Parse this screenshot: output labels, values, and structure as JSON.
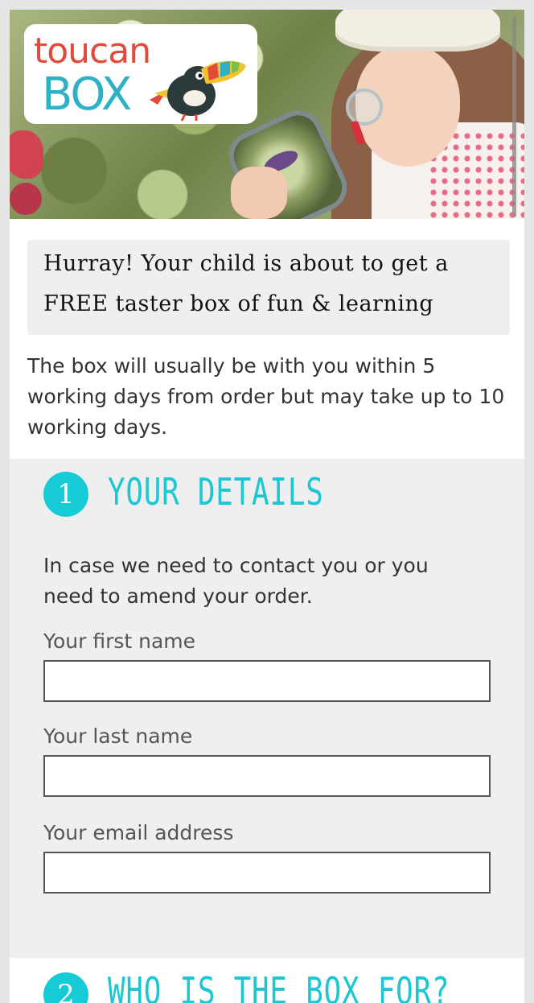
{
  "logo": {
    "word_top": "toucan",
    "word_bottom": "BOX"
  },
  "banner": {
    "line1": "Hurray! Your child is about to get a",
    "line2": "FREE taster box of fun & learning"
  },
  "intro_text": "The box will usually be with you within 5 working days from order but may take up to 10 working days.",
  "section1": {
    "number": "1",
    "title": "YOUR DETAILS",
    "description": "In case we need to contact you or you need to amend your order.",
    "fields": [
      {
        "label": "Your first name",
        "value": ""
      },
      {
        "label": "Your last name",
        "value": ""
      },
      {
        "label": "Your email address",
        "value": ""
      }
    ]
  },
  "section2": {
    "number": "2",
    "title": "WHO IS THE BOX FOR?"
  },
  "colors": {
    "accent": "#1cc6d2",
    "logo_red": "#e24a3b",
    "logo_blue": "#2fb1c5",
    "section_bg": "#efefef"
  },
  "icons": [
    "toucan-bird-icon"
  ]
}
